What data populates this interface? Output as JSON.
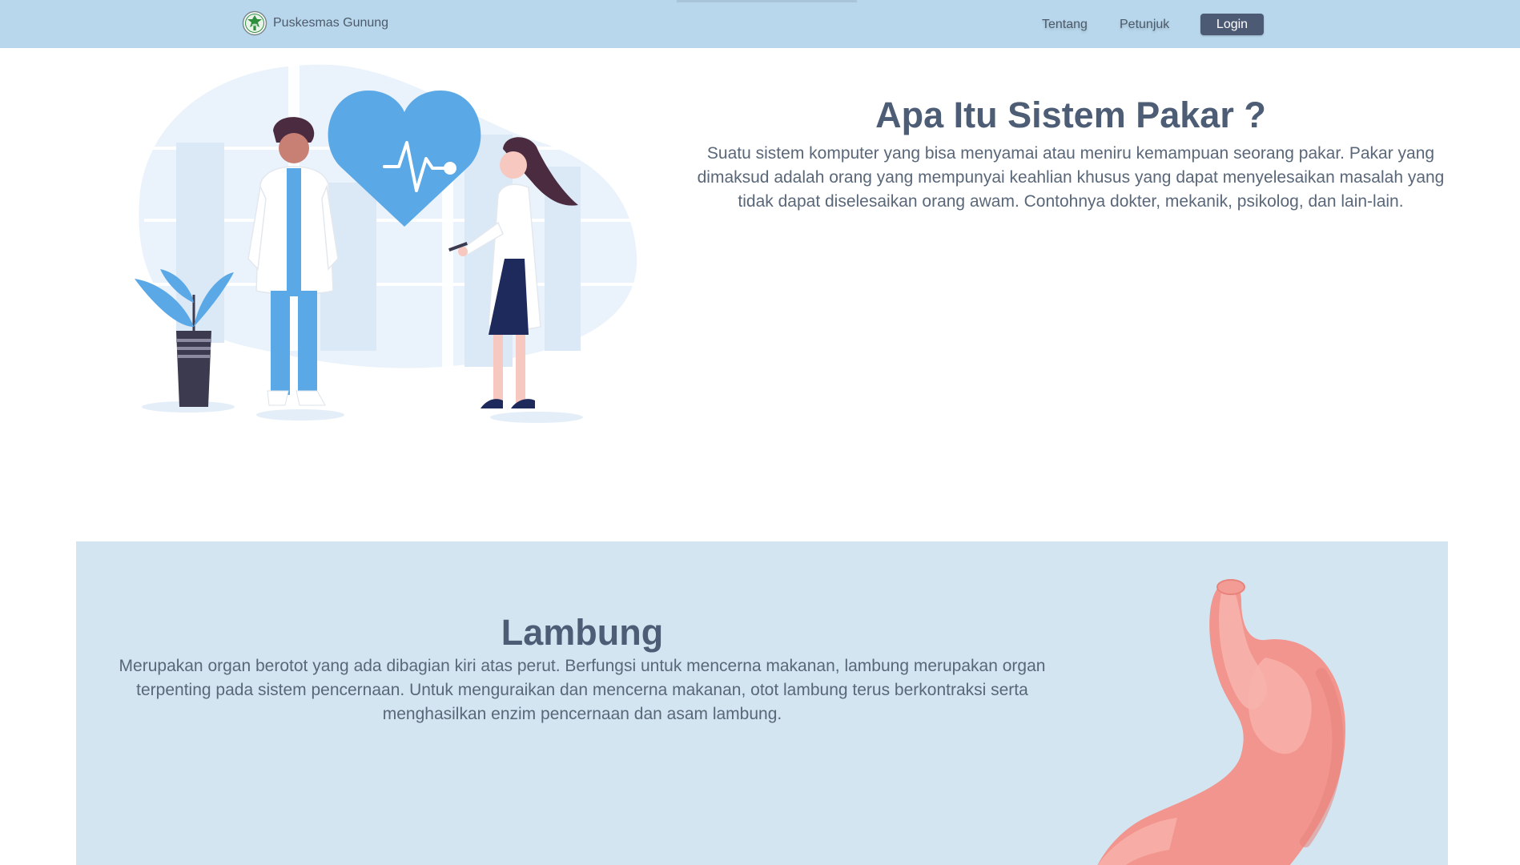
{
  "navbar": {
    "brand_name": "Puskesmas Gunung",
    "logo_icon": "puskesmas-logo-icon",
    "links": [
      "Tentang",
      "Petunjuk"
    ],
    "login_label": "Login"
  },
  "hero": {
    "title": "Apa Itu Sistem Pakar ?",
    "description": "Suatu sistem komputer yang bisa menyamai atau meniru kemampuan seorang pakar. Pakar yang dimaksud adalah orang yang mempunyai keahlian khusus yang dapat menyelesaikan masalah yang tidak dapat diselesaikan orang awam. Contohnya dokter, mekanik, psikolog, dan lain-lain.",
    "illustration": "doctors-illustration"
  },
  "organ": {
    "title": "Lambung",
    "description": "Merupakan organ berotot yang ada dibagian kiri atas perut. Berfungsi untuk mencerna makanan, lambung merupakan organ terpenting pada sistem pencernaan. Untuk menguraikan dan mencerna makanan, otot lambung terus berkontraksi serta menghasilkan enzim pencernaan dan asam lambung.",
    "illustration": "stomach-illustration"
  },
  "colors": {
    "navbar_bg": "#b8d7ec",
    "login_bg": "#4c5a74",
    "section_bg": "#d3e5f1",
    "heading": "#4d5d75",
    "accent_blue": "#5aa8e6",
    "stomach": "#f2958e"
  }
}
